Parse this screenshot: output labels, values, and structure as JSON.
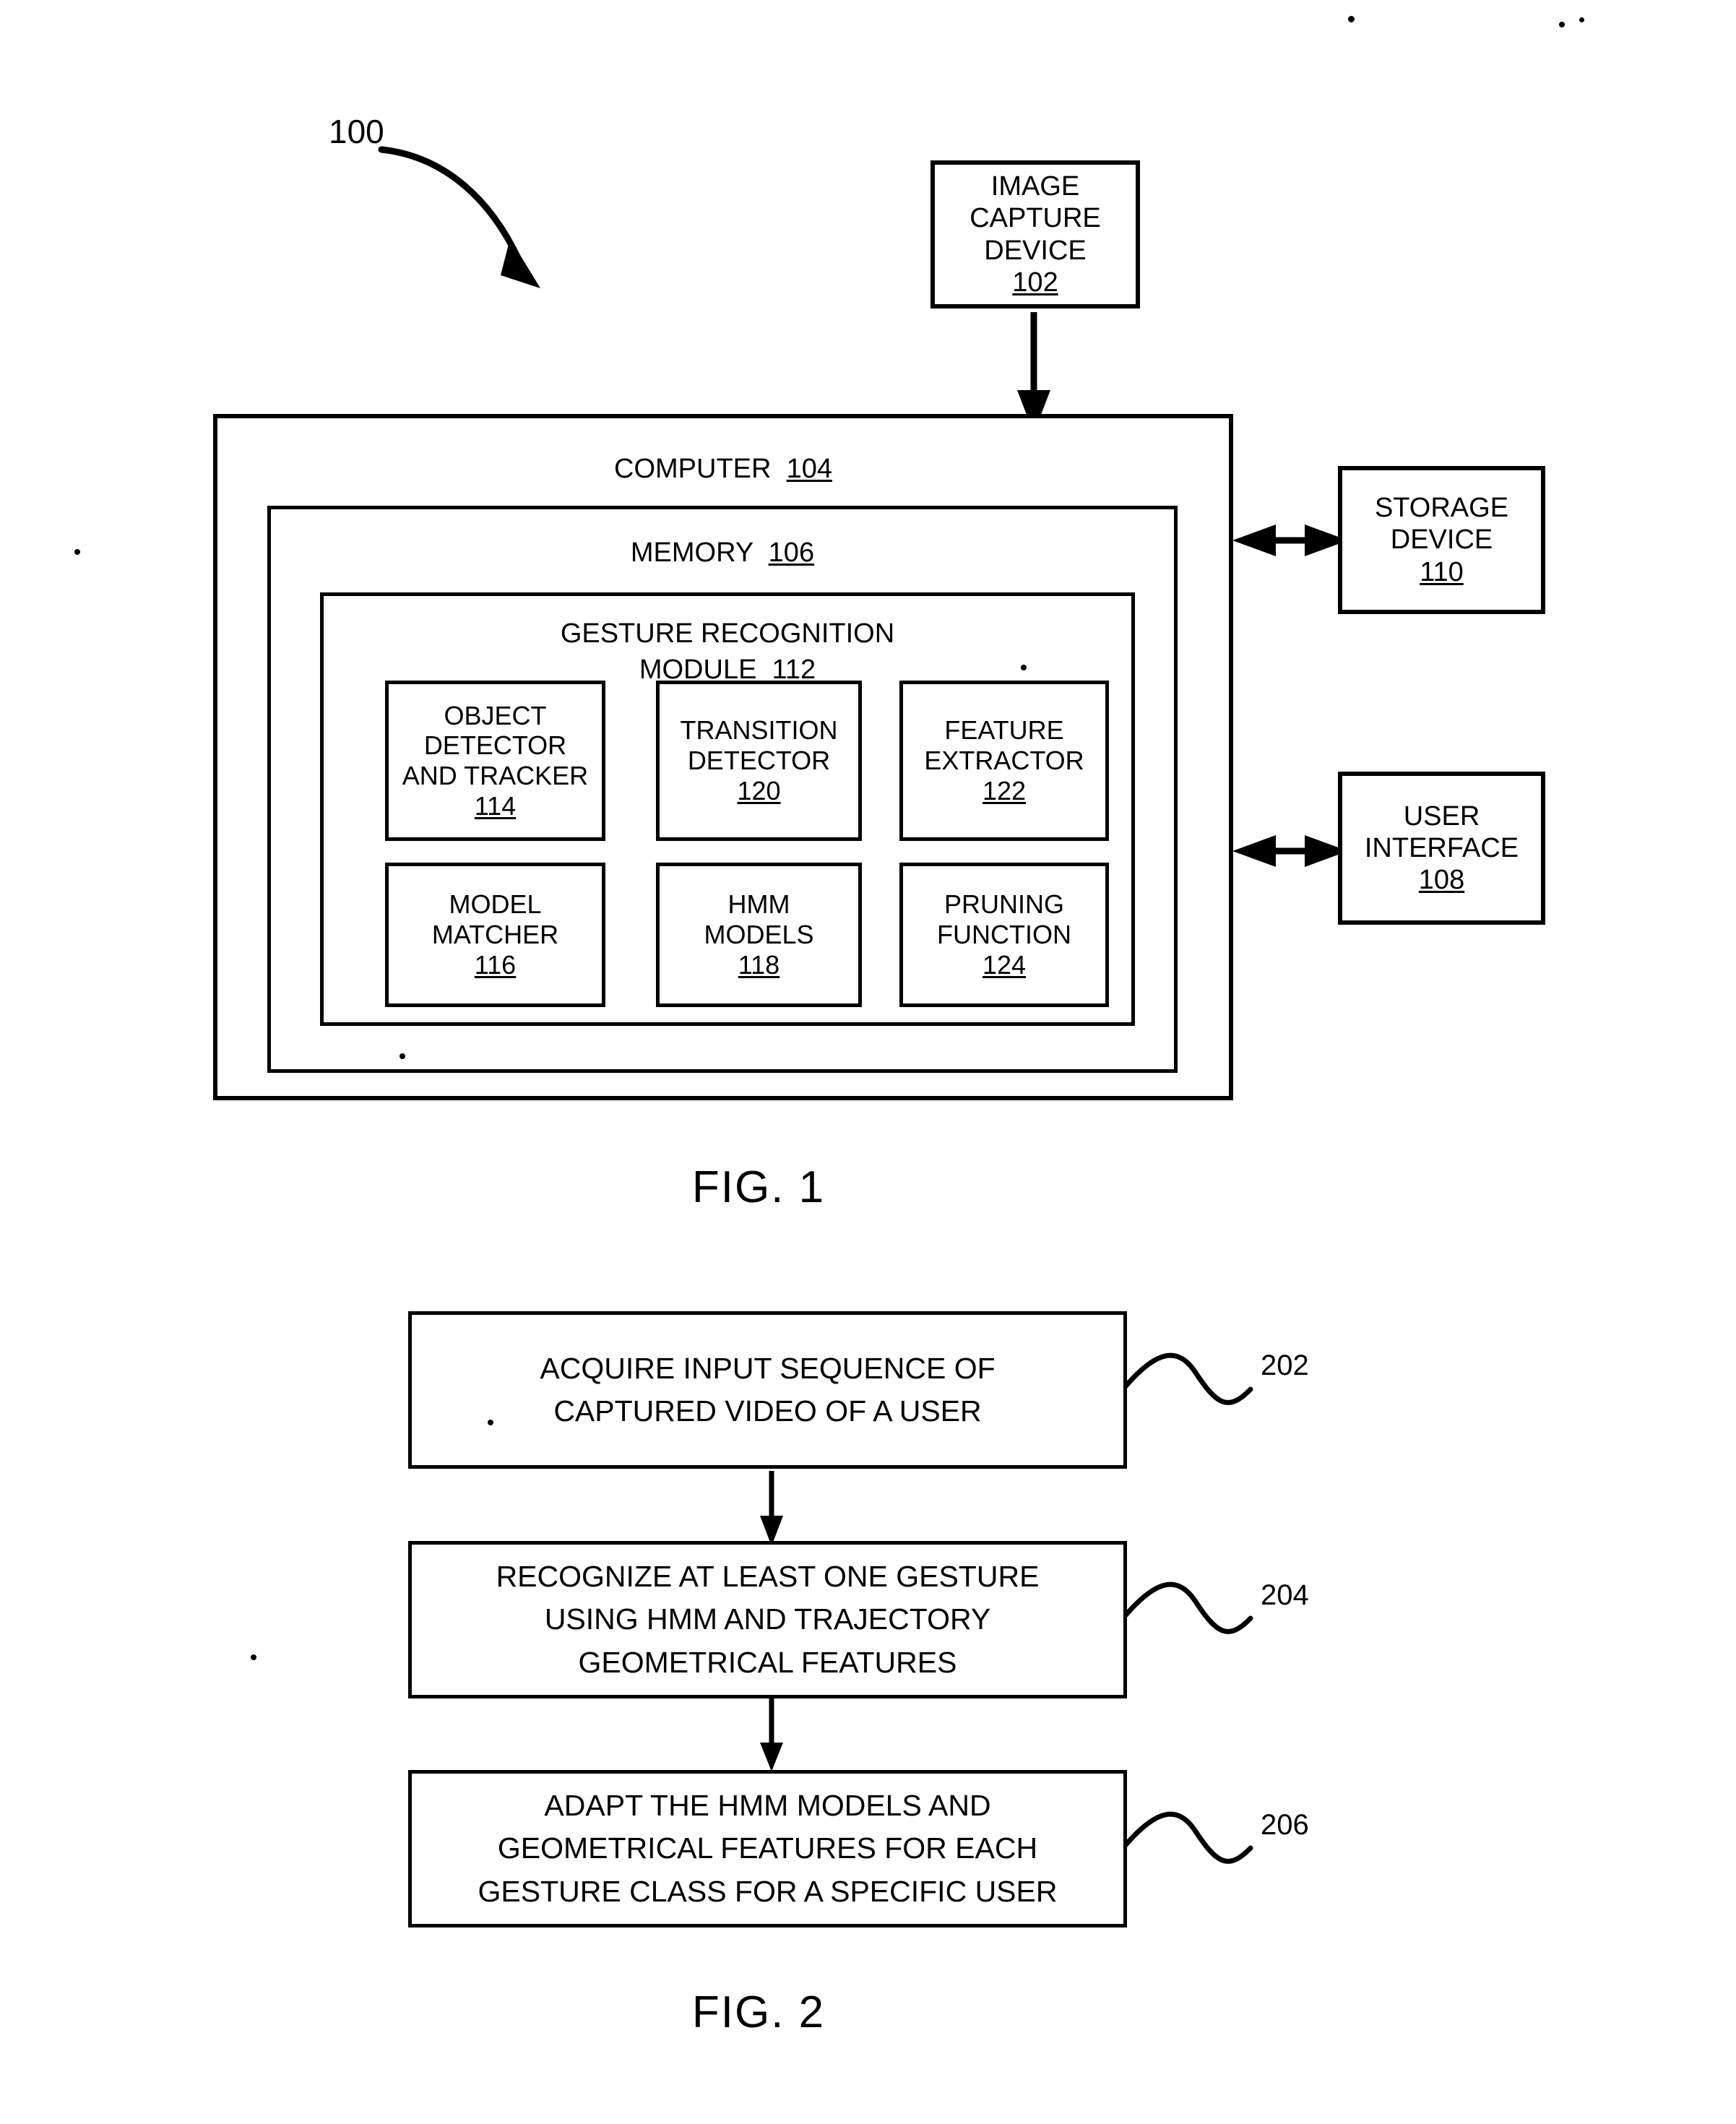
{
  "figure1": {
    "system_ref": "100",
    "caption": "FIG. 1",
    "image_capture_device": {
      "lines": [
        "IMAGE",
        "CAPTURE",
        "DEVICE"
      ],
      "ref": "102"
    },
    "computer": {
      "title": "COMPUTER",
      "ref": "104"
    },
    "memory": {
      "title": "MEMORY",
      "ref": "106"
    },
    "gesture_recognition_module": {
      "title_lines": [
        "GESTURE RECOGNITION",
        "MODULE"
      ],
      "ref": "112"
    },
    "modules": [
      {
        "lines": [
          "OBJECT",
          "DETECTOR",
          "AND TRACKER"
        ],
        "ref": "114"
      },
      {
        "lines": [
          "TRANSITION",
          "DETECTOR"
        ],
        "ref": "120"
      },
      {
        "lines": [
          "FEATURE",
          "EXTRACTOR"
        ],
        "ref": "122"
      },
      {
        "lines": [
          "MODEL",
          "MATCHER"
        ],
        "ref": "116"
      },
      {
        "lines": [
          "HMM",
          "MODELS"
        ],
        "ref": "118"
      },
      {
        "lines": [
          "PRUNING",
          "FUNCTION"
        ],
        "ref": "124"
      }
    ],
    "storage_device": {
      "lines": [
        "STORAGE",
        "DEVICE"
      ],
      "ref": "110"
    },
    "user_interface": {
      "lines": [
        "USER",
        "INTERFACE"
      ],
      "ref": "108"
    }
  },
  "figure2": {
    "caption": "FIG. 2",
    "steps": [
      {
        "lines": [
          "ACQUIRE INPUT SEQUENCE OF",
          "CAPTURED VIDEO OF A USER"
        ],
        "ref": "202"
      },
      {
        "lines": [
          "RECOGNIZE AT LEAST ONE GESTURE",
          "USING HMM AND TRAJECTORY",
          "GEOMETRICAL FEATURES"
        ],
        "ref": "204"
      },
      {
        "lines": [
          "ADAPT THE HMM MODELS AND",
          "GEOMETRICAL FEATURES FOR EACH",
          "GESTURE CLASS FOR A SPECIFIC USER"
        ],
        "ref": "206"
      }
    ]
  },
  "colors": {
    "ink": "#000000",
    "paper": "#ffffff"
  }
}
